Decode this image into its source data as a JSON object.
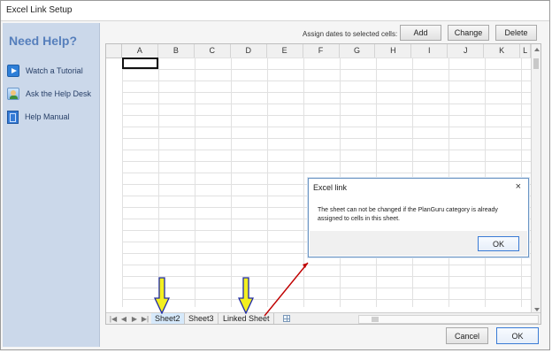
{
  "window": {
    "title": "Excel Link Setup"
  },
  "sidebar": {
    "title": "Need Help?",
    "items": [
      {
        "label": "Watch a Tutorial",
        "icon": "play-video-icon"
      },
      {
        "label": "Ask the Help Desk",
        "icon": "help-desk-icon"
      },
      {
        "label": "Help Manual",
        "icon": "manual-icon"
      }
    ]
  },
  "toolbar": {
    "assign_label": "Assign dates to selected cells:",
    "add_label": "Add",
    "change_label": "Change",
    "delete_label": "Delete"
  },
  "spreadsheet": {
    "columns": [
      "A",
      "B",
      "C",
      "D",
      "E",
      "F",
      "G",
      "H",
      "I",
      "J",
      "K",
      "L"
    ],
    "sheet_tabs": [
      "Sheet2",
      "Sheet3",
      "Linked Sheet"
    ],
    "active_tab": "Sheet2"
  },
  "dialog": {
    "title": "Excel link",
    "close_label": "×",
    "message": "The sheet can not be changed if the PlanGuru category is already assigned to cells in this sheet.",
    "ok_label": "OK"
  },
  "footer": {
    "cancel_label": "Cancel",
    "ok_label": "OK"
  },
  "colors": {
    "sidebar_bg": "#cbd8ea",
    "help_title": "#567fbc",
    "highlight_arrow": "#f3ef20",
    "annotation_line": "#c00000",
    "dialog_border": "#6b95c4"
  }
}
